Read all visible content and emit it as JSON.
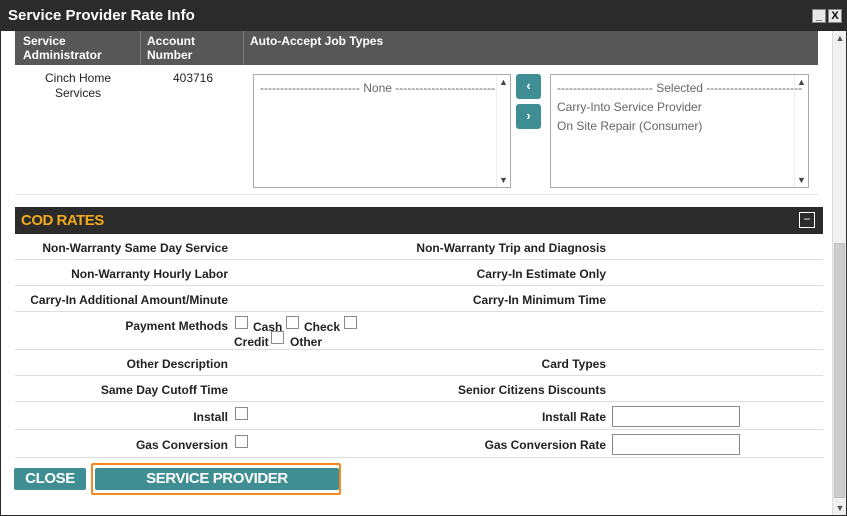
{
  "window": {
    "title": "Service Provider Rate Info",
    "minimize_label": "_",
    "close_label": "X"
  },
  "provider_table": {
    "headers": {
      "service_administrator": [
        "Service",
        "Administrator"
      ],
      "account_number": [
        "Account",
        "Number"
      ],
      "auto_accept": "Auto-Accept Job Types"
    },
    "row": {
      "service_administrator": [
        "Cinch Home",
        "Services"
      ],
      "account_number": "403716"
    },
    "available_list": {
      "header": "------------------------- None -------------------------",
      "items": []
    },
    "selected_list": {
      "header": "------------------------ Selected ------------------------",
      "items": [
        "Carry-Into Service Provider",
        "On Site Repair (Consumer)"
      ]
    },
    "move_left_label": "‹",
    "move_right_label": "›"
  },
  "cod_rates": {
    "title": "COD RATES",
    "collapse_label": "−",
    "rows": [
      {
        "left_label": "Non-Warranty Same Day Service",
        "right_label": "Non-Warranty Trip and Diagnosis"
      },
      {
        "left_label": "Non-Warranty Hourly Labor",
        "right_label": "Carry-In Estimate Only"
      },
      {
        "left_label": "Carry-In Additional Amount/Minute",
        "right_label": "Carry-In Minimum Time"
      }
    ],
    "payment_methods": {
      "label": "Payment Methods",
      "options": [
        "Cash",
        "Check",
        "Credit",
        "Other"
      ]
    },
    "other_description_label": "Other Description",
    "card_types_label": "Card Types",
    "same_day_cutoff_label": "Same Day Cutoff Time",
    "senior_discounts_label": "Senior Citizens Discounts",
    "install_label": "Install",
    "install_rate_label": "Install Rate",
    "install_rate_value": "",
    "gas_conversion_label": "Gas Conversion",
    "gas_conversion_rate_label": "Gas Conversion Rate",
    "gas_conversion_rate_value": ""
  },
  "actions": {
    "close_label": "CLOSE",
    "maintenance_label": "SERVICE PROVIDER MAINTENANCE"
  },
  "colors": {
    "accent": "#3e8e94",
    "header_bg": "#2b2b2b",
    "cod_title": "#f0a91e",
    "focus_outline": "#f28a1e"
  }
}
